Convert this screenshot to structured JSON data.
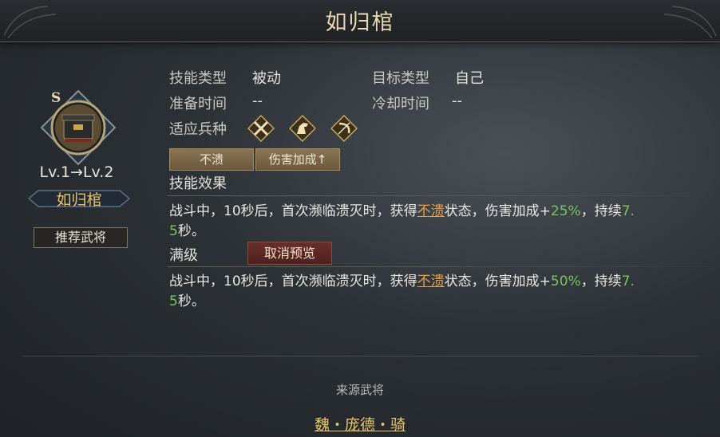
{
  "title": "如归棺",
  "skill": {
    "grade": "S",
    "level_text": "Lv.1→Lv.2",
    "name": "如归棺",
    "recommend_button": "推荐武将"
  },
  "info": {
    "skill_type_label": "技能类型",
    "skill_type_value": "被动",
    "target_type_label": "目标类型",
    "target_type_value": "自己",
    "prep_time_label": "准备时间",
    "prep_time_value": "--",
    "cooldown_label": "冷却时间",
    "cooldown_value": "--",
    "troop_label": "适应兵种",
    "troop_icons": [
      "crossed-swords-icon",
      "horse-icon",
      "bow-icon"
    ]
  },
  "tags": [
    "不溃",
    "伤害加成↑"
  ],
  "effect_label": "技能效果",
  "effect": {
    "pre": "战斗中，10秒后，首次濒临溃灭时，获得",
    "status": "不溃",
    "mid": "状态，伤害加成+",
    "pct": "25%",
    "post": "，持续",
    "dur_a": "7.",
    "dur_b": "5",
    "end": "秒。"
  },
  "max_label": "满级",
  "cancel_preview": "取消预览",
  "max_effect": {
    "pre": "战斗中，10秒后，首次濒临溃灭时，获得",
    "status": "不溃",
    "mid": "状态，伤害加成+",
    "pct": "50%",
    "post": "，持续",
    "dur_a": "7.",
    "dur_b": "5",
    "end": "秒。"
  },
  "source_label": "来源武将",
  "source_name": "魏・庞德・骑",
  "colors": {
    "gold": "#e9c56a",
    "highlight": "#e9a04a",
    "green": "#7cc45a"
  }
}
